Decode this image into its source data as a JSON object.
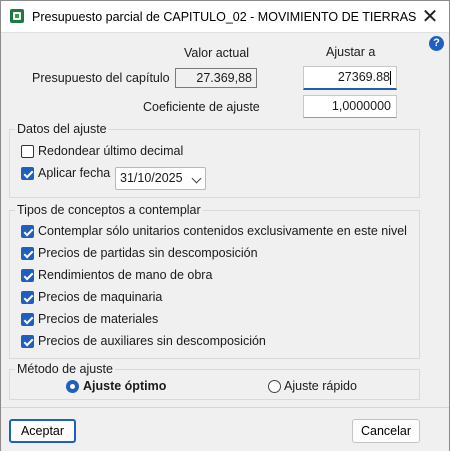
{
  "window": {
    "title": "Presupuesto parcial de CAPITULO_02 - MOVIMIENTO DE TIERRAS",
    "icon": "spreadsheet-icon",
    "close_glyph": "✕"
  },
  "help": {
    "glyph": "?"
  },
  "header": {
    "valor_actual_label": "Valor actual",
    "ajustar_label": "Ajustar a"
  },
  "presupuesto": {
    "label": "Presupuesto del capítulo",
    "valor_actual": "27.369,88",
    "ajustar_a": "27369.88"
  },
  "coeficiente": {
    "label": "Coeficiente de ajuste",
    "value": "1,0000000"
  },
  "datos_ajuste": {
    "title": "Datos del ajuste",
    "redondear": {
      "label": "Redondear último decimal",
      "checked": false
    },
    "aplicar_fecha": {
      "label": "Aplicar fecha",
      "checked": true
    },
    "fecha": "31/10/2025"
  },
  "tipos": {
    "title": "Tipos de conceptos a contemplar",
    "items": [
      {
        "label": "Contemplar sólo unitarios contenidos exclusivamente en este nivel",
        "checked": true
      },
      {
        "label": "Precios de partidas sin descomposición",
        "checked": true
      },
      {
        "label": "Rendimientos de mano de obra",
        "checked": true
      },
      {
        "label": "Precios de maquinaria",
        "checked": true
      },
      {
        "label": "Precios de materiales",
        "checked": true
      },
      {
        "label": "Precios de auxiliares sin descomposición",
        "checked": true
      }
    ]
  },
  "metodo": {
    "title": "Método de ajuste",
    "optimo": {
      "label": "Ajuste óptimo",
      "selected": true
    },
    "rapido": {
      "label": "Ajuste rápido",
      "selected": false
    }
  },
  "footer": {
    "accept_label": "Aceptar",
    "cancel_label": "Cancelar"
  },
  "colors": {
    "accent": "#1f5fbf",
    "background": "#f0f0f0",
    "app_icon": "#1e7a3c"
  }
}
